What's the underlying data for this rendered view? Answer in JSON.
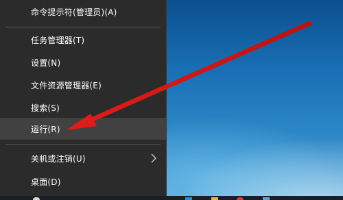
{
  "context_menu": {
    "items": [
      {
        "label": "命令提示符(管理员)(A)"
      },
      {
        "label": "任务管理器(T)"
      },
      {
        "label": "设置(N)"
      },
      {
        "label": "文件资源管理器(E)"
      },
      {
        "label": "搜索(S)"
      },
      {
        "label": "运行(R)",
        "highlighted": true
      },
      {
        "label": "关机或注销(U)",
        "has_submenu": true
      },
      {
        "label": "桌面(D)"
      }
    ]
  },
  "annotation": {
    "color": "#e01b1b"
  },
  "colors": {
    "menu_background": "#2b2b2b",
    "menu_highlight": "#414141",
    "menu_text": "#ffffff"
  }
}
